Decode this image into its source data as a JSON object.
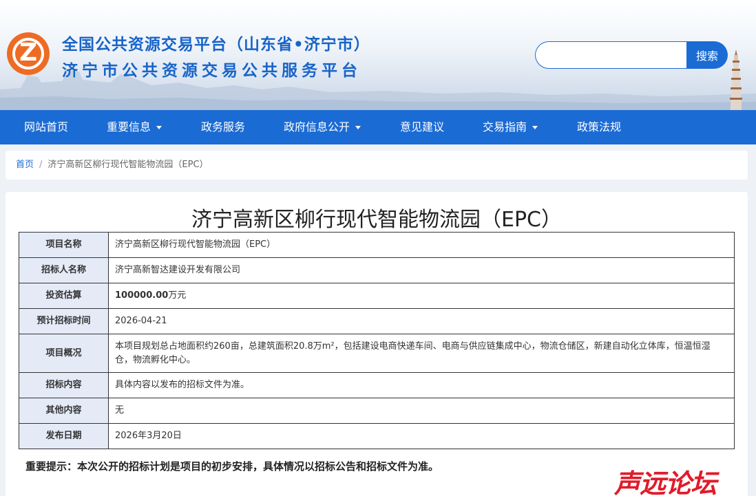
{
  "header": {
    "title_line1": "全国公共资源交易平台（山东省•济宁市）",
    "title_line2": "济宁市公共资源交易公共服务平台",
    "search_placeholder": "",
    "search_button": "搜索"
  },
  "nav": {
    "items": [
      {
        "label": "网站首页",
        "dropdown": false
      },
      {
        "label": "重要信息",
        "dropdown": true
      },
      {
        "label": "政务服务",
        "dropdown": false
      },
      {
        "label": "政府信息公开",
        "dropdown": true
      },
      {
        "label": "意见建议",
        "dropdown": false
      },
      {
        "label": "交易指南",
        "dropdown": true
      },
      {
        "label": "政策法规",
        "dropdown": false
      }
    ]
  },
  "breadcrumb": {
    "home": "首页",
    "separator": "/",
    "current": "济宁高新区柳行现代智能物流园（EPC）"
  },
  "detail": {
    "title": "济宁高新区柳行现代智能物流园（EPC）",
    "rows": [
      {
        "label": "项目名称",
        "value": "济宁高新区柳行现代智能物流园（EPC）"
      },
      {
        "label": "招标人名称",
        "value": "济宁高新智达建设开发有限公司"
      },
      {
        "label": "投资估算",
        "value_bold": "100000.00",
        "value_unit": "万元"
      },
      {
        "label": "预计招标时间",
        "value": "2026-04-21"
      },
      {
        "label": "项目概况",
        "value": "本项目规划总占地面积约260亩，总建筑面积20.8万m²，包括建设电商快递车间、电商与供应链集成中心，物流仓储区，新建自动化立体库，恒温恒湿仓，物流孵化中心。"
      },
      {
        "label": "招标内容",
        "value": "具体内容以发布的招标文件为准。"
      },
      {
        "label": "其他内容",
        "value": "无"
      },
      {
        "label": "发布日期",
        "value": "2026年3月20日"
      }
    ],
    "notice": "重要提示：本次公开的招标计划是项目的初步安排，具体情况以招标公告和招标文件为准。"
  },
  "watermark": "声远论坛",
  "colors": {
    "brand_blue": "#1b6bd4",
    "logo_orange": "#ee6b24",
    "label_bg": "#e4ebf7",
    "watermark_red": "#e01b2a"
  }
}
